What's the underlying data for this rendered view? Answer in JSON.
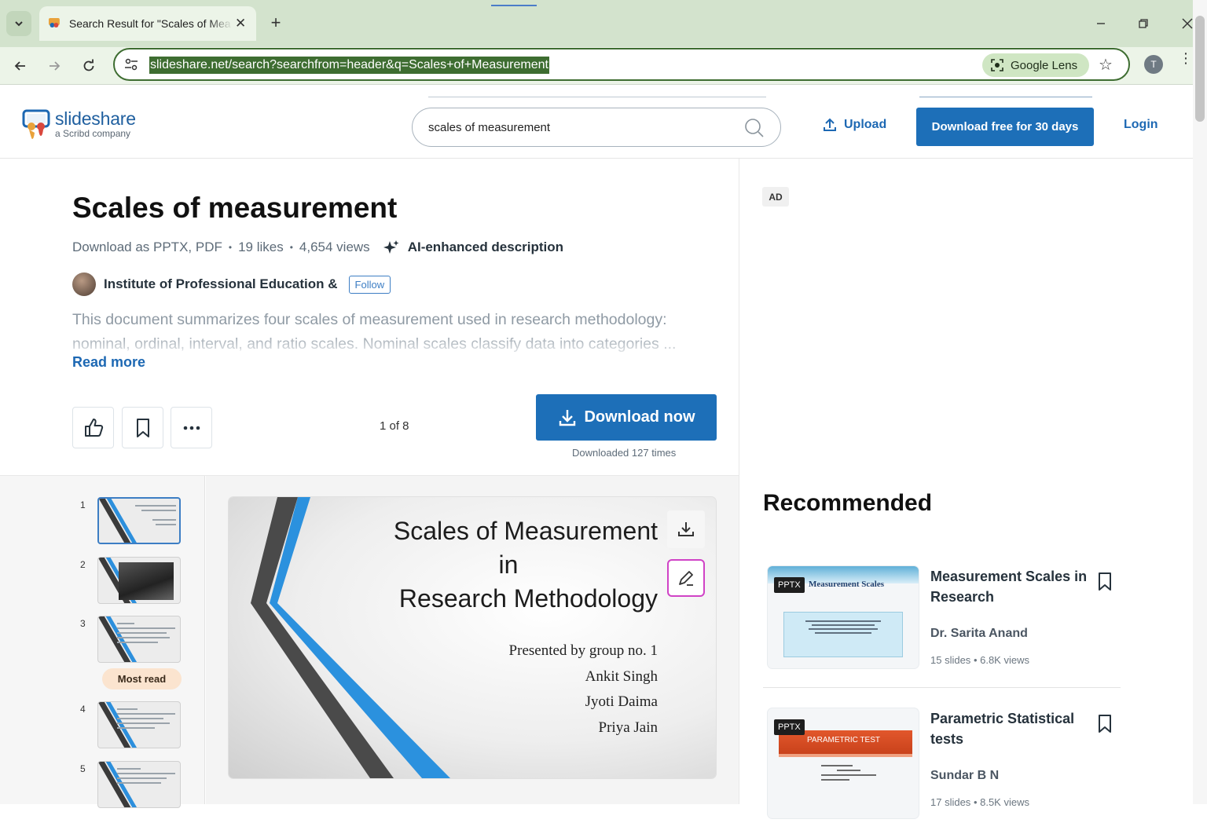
{
  "browser": {
    "tab_title": "Search Result for \"Scales of Mea",
    "url": "slideshare.net/search?searchfrom=header&q=Scales+of+Measurement",
    "lens_label": "Google Lens",
    "profile_initial": "T"
  },
  "header": {
    "logo_word": "slideshare",
    "logo_sub": "a Scribd company",
    "search_value": "scales of measurement",
    "upload_label": "Upload",
    "download_free_label": "Download free for 30 days",
    "login_label": "Login"
  },
  "document": {
    "title": "Scales of measurement",
    "download_as": "Download as PPTX, PDF",
    "likes": "19 likes",
    "views": "4,654 views",
    "ai_label": "AI-enhanced description",
    "author": "Institute of Professional Education &",
    "follow_label": "Follow",
    "summary": "This document summarizes four scales of measurement used in research methodology: nominal, ordinal, interval, and ratio scales. Nominal scales classify data into categories ...",
    "read_more": "Read more",
    "page_indicator": "1 of 8",
    "download_now": "Download now",
    "downloaded_count": "Downloaded 127 times"
  },
  "thumbnails": {
    "numbers": [
      "1",
      "2",
      "3",
      "4",
      "5"
    ],
    "most_read_label": "Most read"
  },
  "slide": {
    "title_line1": "Scales of Measurement",
    "title_line2": "in",
    "title_line3": "Research Methodology",
    "presented_by": "Presented by group no. 1",
    "presenters": [
      "Ankit Singh",
      "Jyoti Daima",
      "Priya Jain"
    ]
  },
  "sidebar": {
    "ad_label": "AD",
    "recommended_heading": "Recommended",
    "cards": [
      {
        "badge": "PPTX",
        "thumb_heading": "Measurement Scales",
        "title": "Measurement Scales in Research",
        "author": "Dr. Sarita Anand",
        "slides": "15 slides",
        "views": "6.8K views"
      },
      {
        "badge": "PPTX",
        "thumb_heading": "PARAMETRIC TEST",
        "title": "Parametric Statistical tests",
        "author": "Sundar B N",
        "slides": "17 slides",
        "views": "8.5K views"
      }
    ]
  },
  "colors": {
    "brand_blue": "#1d6fb8",
    "link_blue": "#1d68b3",
    "chrome_green": "#d3e3cd",
    "highlight_green": "#3e6d31",
    "edit_magenta": "#d043c6"
  }
}
